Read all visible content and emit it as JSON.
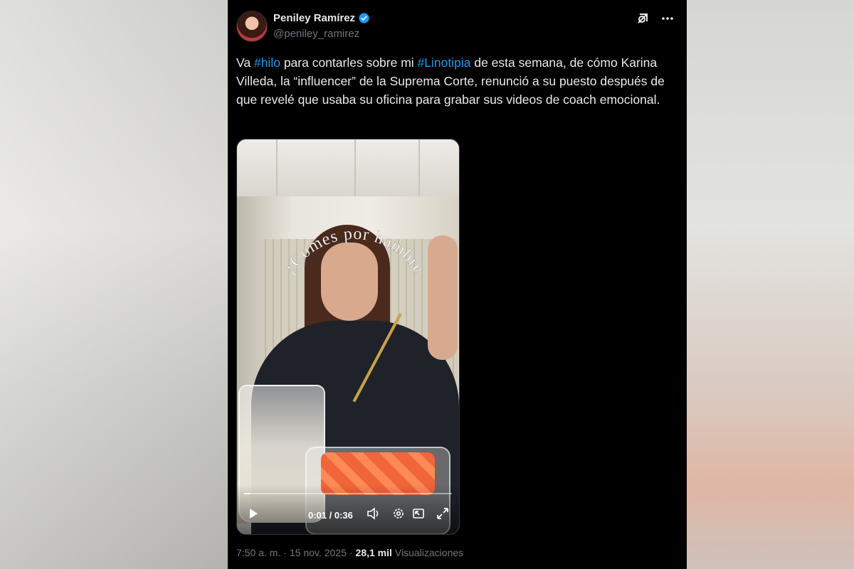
{
  "author": {
    "display_name": "Peniley Ramírez",
    "handle": "@peniley_ramirez"
  },
  "post": {
    "text_parts": [
      {
        "text": "Va ",
        "hashtag": false
      },
      {
        "text": "#hilo",
        "hashtag": true
      },
      {
        "text": " para contarles sobre mi ",
        "hashtag": false
      },
      {
        "text": "#Linotipia",
        "hashtag": true
      },
      {
        "text": " de esta semana, de cómo Karina Villeda, la “influencer” de la Suprema Corte, renunció a su puesto después de que revelé que usaba su oficina para grabar sus videos de coach emocional.",
        "hashtag": false
      }
    ]
  },
  "video": {
    "overlay_text": "¿Comes por hambre",
    "time_display": "0:01 / 0:36",
    "progress_fraction": 0.028
  },
  "footer": {
    "time": "7:50 a. m.",
    "date": "15 nov. 2025",
    "separator": "·",
    "views_count": "28,1 mil",
    "views_label": "Visualizaciones"
  },
  "icons": {
    "verified": "verified-badge-icon",
    "grok": "grok-icon",
    "more": "more-icon",
    "play": "play-icon",
    "volume": "volume-icon",
    "settings": "settings-icon",
    "pip": "picture-in-picture-icon",
    "fullscreen": "fullscreen-icon"
  },
  "colors": {
    "background": "#000000",
    "text": "#e7e9ea",
    "secondary_text": "#71767b",
    "hashtag": "#1d9bf0",
    "verified": "#1d9bf0"
  }
}
